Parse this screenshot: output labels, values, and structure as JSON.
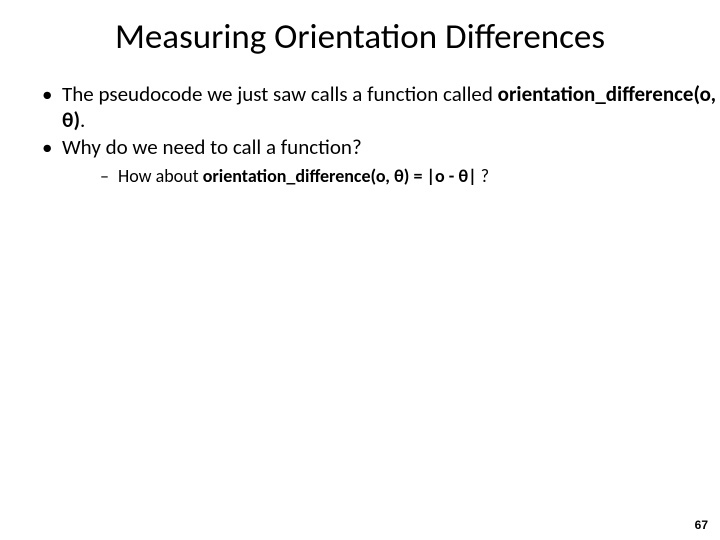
{
  "title": "Measuring Orientation Differences",
  "bullets": {
    "b1_pre": "The pseudocode we just saw calls a function called ",
    "b1_bold": "orientation_difference(o, θ)",
    "b1_post": ".",
    "b2": "Why do we need to call a function?",
    "b2_sub_pre": "How about ",
    "b2_sub_bold": "orientation_difference(o, θ) = |o - θ|",
    "b2_sub_post": " ?"
  },
  "page_number": "67"
}
